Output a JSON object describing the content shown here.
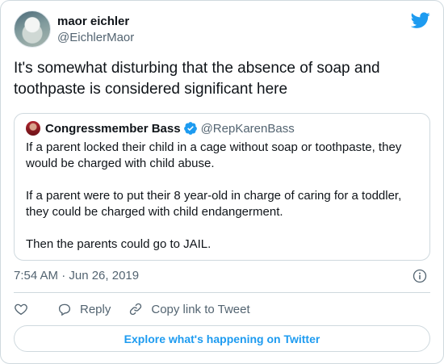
{
  "author": {
    "name": "maor eichler",
    "handle": "@EichlerMaor"
  },
  "tweet": {
    "text": "It's somewhat disturbing that the absence of soap and toothpaste is considered significant here"
  },
  "quoted_tweet": {
    "name": "Congressmember Bass",
    "handle": "@RepKarenBass",
    "verified": true,
    "paragraphs": [
      "If a parent locked their child in a cage without soap or toothpaste, they would be charged with child abuse.",
      "If a parent were to put their 8 year-old in charge of caring for a toddler, they could be charged with child endangerment.",
      "Then the parents could go to JAIL."
    ]
  },
  "meta": {
    "timestamp": "7:54 AM · Jun 26, 2019"
  },
  "actions": {
    "reply_label": "Reply",
    "copy_link_label": "Copy link to Tweet"
  },
  "cta": {
    "label": "Explore what's happening on Twitter"
  },
  "colors": {
    "brand": "#1d9bf0",
    "text": "#0f1419",
    "muted": "#536471",
    "border": "#cfd9de"
  },
  "icons": {
    "logo": "twitter-bird-icon",
    "verified": "verified-badge-icon",
    "info": "info-icon",
    "like": "heart-icon",
    "reply": "speech-bubble-icon",
    "copy": "link-icon"
  }
}
